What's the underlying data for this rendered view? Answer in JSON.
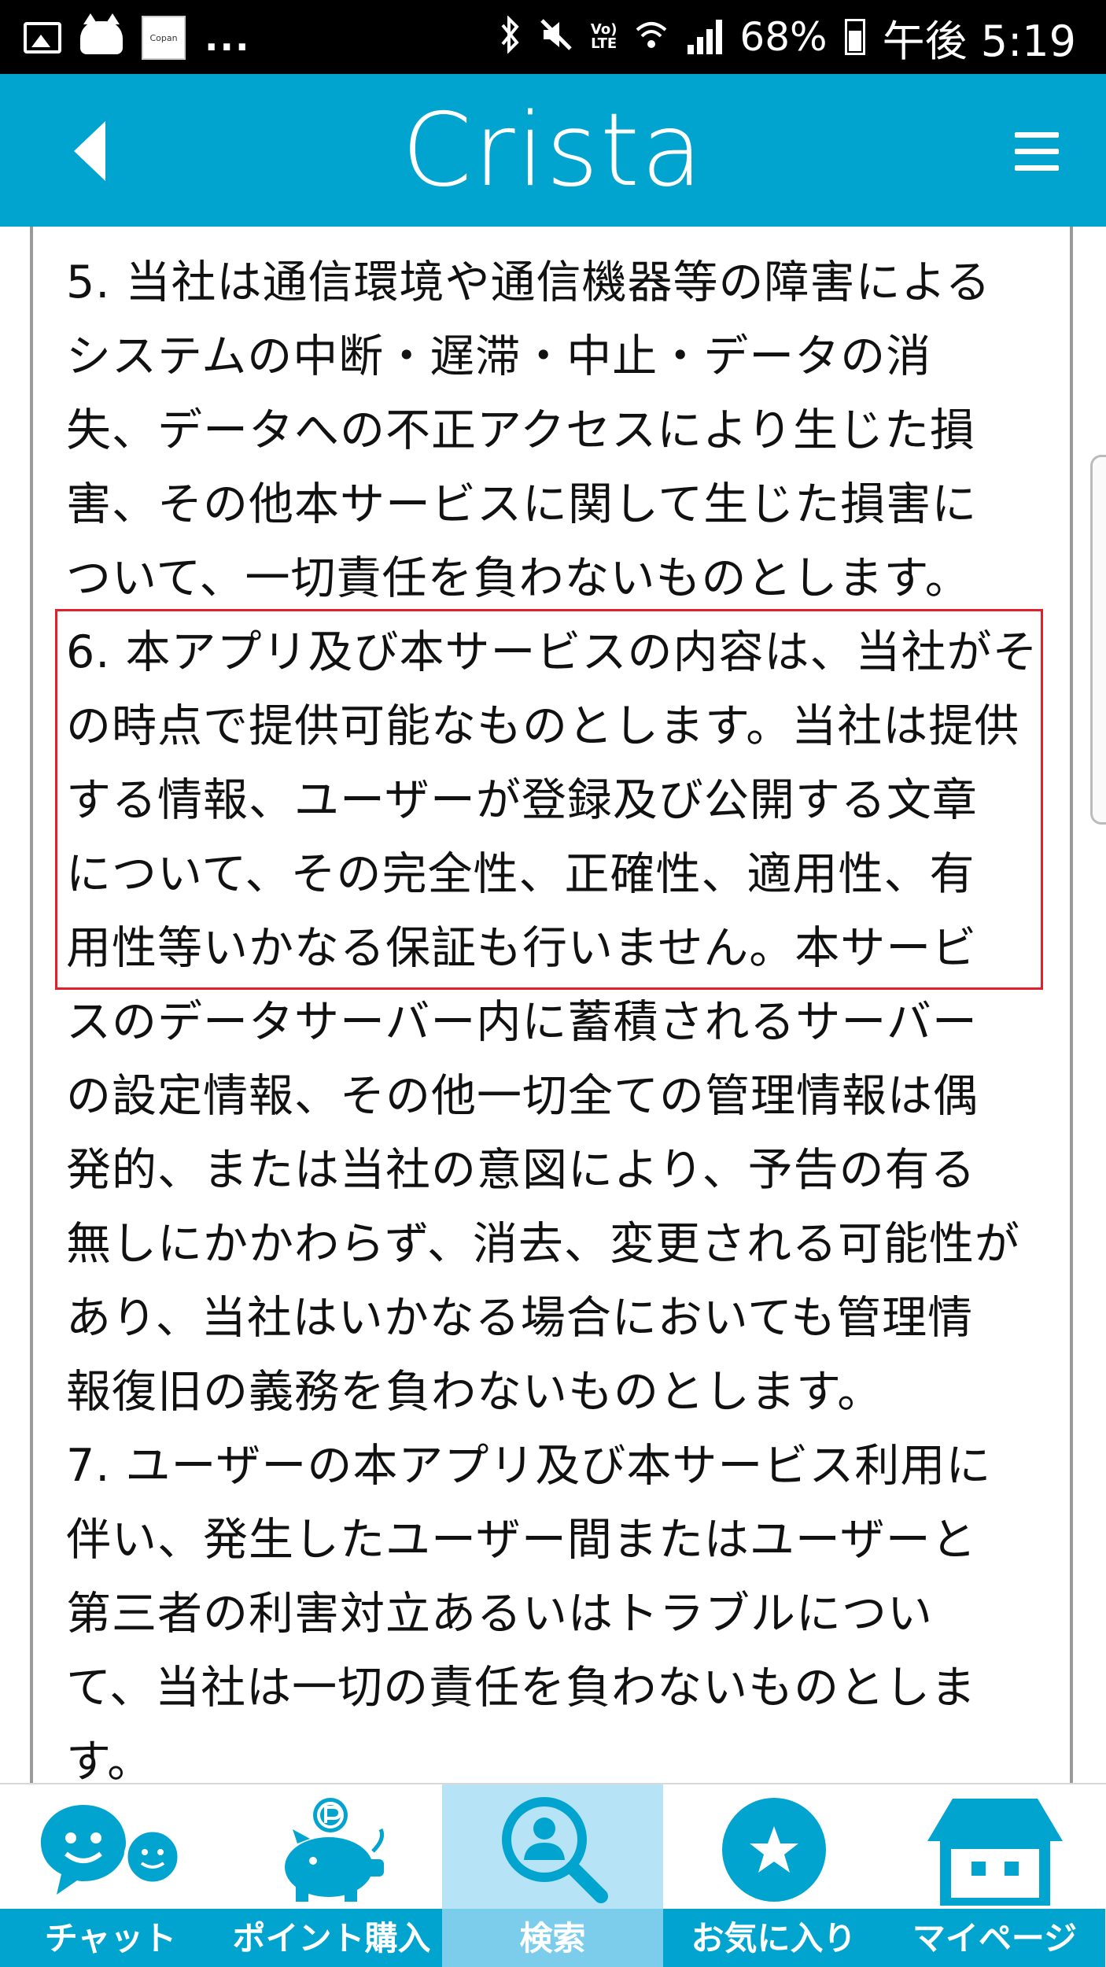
{
  "status_bar": {
    "left_icons": [
      "image-icon",
      "cat-icon",
      "copan-icon"
    ],
    "copan_text": "Copan",
    "more": "...",
    "icons": [
      "bluetooth-icon",
      "mute-icon",
      "volte-icon",
      "wifi-icon",
      "signal-icon"
    ],
    "lte_top": "Vo)",
    "lte_bottom": "LTE",
    "battery": "68%",
    "time": "午後 5:19"
  },
  "header": {
    "title": "Crista",
    "back_icon": "back-arrow-icon",
    "menu_icon": "hamburger-menu-icon",
    "color": "#00a4cf"
  },
  "content": {
    "partial_line": "ものとします。",
    "lines": [
      "5. 当社は通信環境や通信機器等の障害による",
      "システムの中断・遅滞・中止・データの消",
      "失、データへの不正アクセスにより生じた損",
      "害、その他本サービスに関して生じた損害に",
      "ついて、一切責任を負わないものとします。",
      "6. 本アプリ及び本サービスの内容は、当社がそ",
      "の時点で提供可能なものとします。当社は提供",
      "する情報、ユーザーが登録及び公開する文章",
      "について、その完全性、正確性、適用性、有",
      "用性等いかなる保証も行いません。本サービ",
      "スのデータサーバー内に蓄積されるサーバー",
      "の設定情報、その他一切全ての管理情報は偶",
      "発的、または当社の意図により、予告の有る",
      "無しにかかわらず、消去、変更される可能性が",
      "あり、当社はいかなる場合においても管理情",
      "報復旧の義務を負わないものとします。",
      "7. ユーザーの本アプリ及び本サービス利用に",
      "伴い、発生したユーザー間またはユーザーと",
      "第三者の利害対立あるいはトラブルについ",
      "て、当社は一切の責任を負わないものとしま",
      "す。"
    ],
    "highlight_color": "#e0202a"
  },
  "bottom_nav": {
    "items": [
      {
        "label": "チャット",
        "icon": "chat-bubbles-icon"
      },
      {
        "label": "ポイント購入",
        "icon": "piggy-bank-icon"
      },
      {
        "label": "検索",
        "icon": "search-user-icon",
        "active": true
      },
      {
        "label": "お気に入り",
        "icon": "star-icon"
      },
      {
        "label": "マイページ",
        "icon": "house-icon"
      }
    ],
    "accent": "#00a4cf",
    "active_bg": "#b6e3f6"
  }
}
